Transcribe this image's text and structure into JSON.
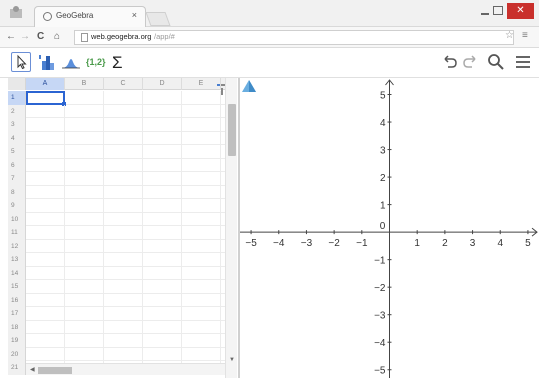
{
  "browser": {
    "tab_title": "GeoGebra",
    "tab_close": "×",
    "url_host": "web.geogebra.org",
    "url_path": "/app/#",
    "nav": {
      "back": "←",
      "forward": "→",
      "reload": "C",
      "home": "⌂"
    },
    "window": {
      "close": "✕"
    }
  },
  "toolbar": {
    "tools": [
      {
        "name": "move-tool",
        "icon": "cursor-arrow-icon"
      },
      {
        "name": "one-variable-analysis-tool",
        "icon": "bar-chart-icon"
      },
      {
        "name": "normal-distribution-tool",
        "icon": "distribution-icon"
      },
      {
        "name": "create-list-tool",
        "label": "{1,2}"
      },
      {
        "name": "sum-tool",
        "label": "Σ"
      }
    ],
    "right": [
      "undo-icon",
      "redo-icon",
      "search-icon",
      "menu-icon"
    ]
  },
  "spreadsheet": {
    "columns": [
      "A",
      "B",
      "C",
      "D",
      "E"
    ],
    "rows": [
      "1",
      "2",
      "3",
      "4",
      "5",
      "6",
      "7",
      "8",
      "9",
      "10",
      "11",
      "12",
      "13",
      "14",
      "15",
      "16",
      "17",
      "18",
      "19",
      "20",
      "21"
    ],
    "selected_cell": "A1"
  },
  "graphics": {
    "x_ticks": [
      "-5",
      "-4",
      "-3",
      "-2",
      "-1",
      "0",
      "1",
      "2",
      "3",
      "4",
      "5"
    ],
    "y_ticks": [
      "5",
      "4",
      "3",
      "2",
      "1",
      "-1",
      "-2",
      "-3",
      "-4",
      "-5"
    ],
    "x_range": [
      -5.4,
      5.4
    ],
    "y_range": [
      -5.3,
      5.6
    ],
    "grid": false
  },
  "colors": {
    "accent": "#2b64d2",
    "selection": "#c6d7f5",
    "close_button": "#c9302c",
    "list_tool": "#4a9a4a"
  }
}
